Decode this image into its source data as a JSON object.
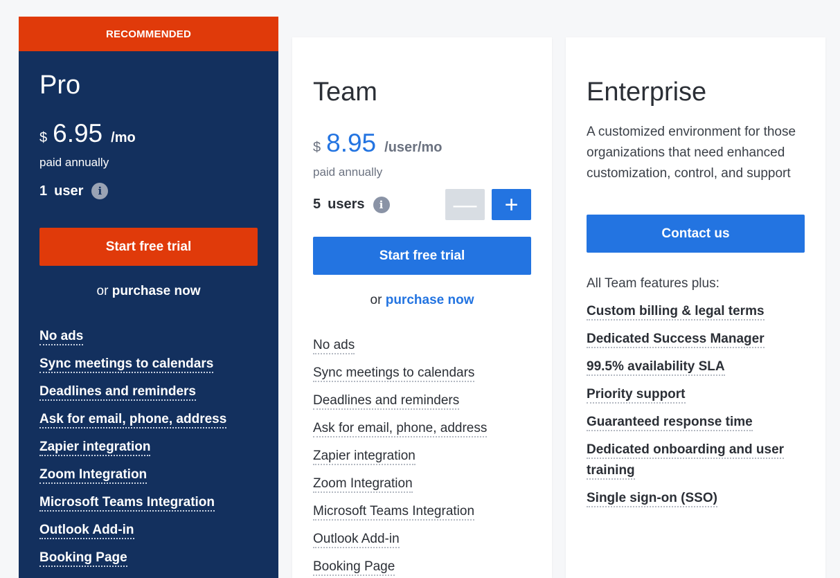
{
  "pro": {
    "ribbon": "RECOMMENDED",
    "title": "Pro",
    "currency": "$",
    "price": "6.95",
    "period": "/mo",
    "billing": "paid annually",
    "users_count": "1",
    "users_label": "user",
    "info_glyph": "i",
    "cta": "Start free trial",
    "purchase_prefix": "or",
    "purchase_link": "purchase now",
    "features": [
      "No ads",
      "Sync meetings to calendars",
      "Deadlines and reminders",
      "Ask for email, phone, address",
      "Zapier integration",
      "Zoom Integration",
      "Microsoft Teams Integration",
      "Outlook Add-in",
      "Booking Page"
    ]
  },
  "team": {
    "title": "Team",
    "currency": "$",
    "price": "8.95",
    "period": "/user/mo",
    "billing": "paid annually",
    "users_count": "5",
    "users_label": "users",
    "info_glyph": "i",
    "minus_glyph": "—",
    "plus_glyph": "+",
    "cta": "Start free trial",
    "purchase_prefix": "or",
    "purchase_link": "purchase now",
    "features": [
      "No ads",
      "Sync meetings to calendars",
      "Deadlines and reminders",
      "Ask for email, phone, address",
      "Zapier integration",
      "Zoom Integration",
      "Microsoft Teams Integration",
      "Outlook Add-in",
      "Booking Page"
    ]
  },
  "enterprise": {
    "title": "Enterprise",
    "description": "A customized environment for those organizations that need enhanced customization, control, and support",
    "cta": "Contact us",
    "plus_label": "All Team features plus:",
    "features": [
      "Custom billing & legal terms",
      "Dedicated Success Manager",
      "99.5% availability SLA",
      "Priority support",
      "Guaranteed response time",
      "Dedicated onboarding and user training",
      "Single sign-on (SSO)"
    ]
  },
  "colors": {
    "pro_background": "#13305e",
    "accent_orange": "#e03a0a",
    "accent_blue": "#2374e1",
    "page_background": "#f6f7f9"
  },
  "icons": {
    "info": "info-icon",
    "minus": "minus-icon",
    "plus": "plus-icon"
  }
}
